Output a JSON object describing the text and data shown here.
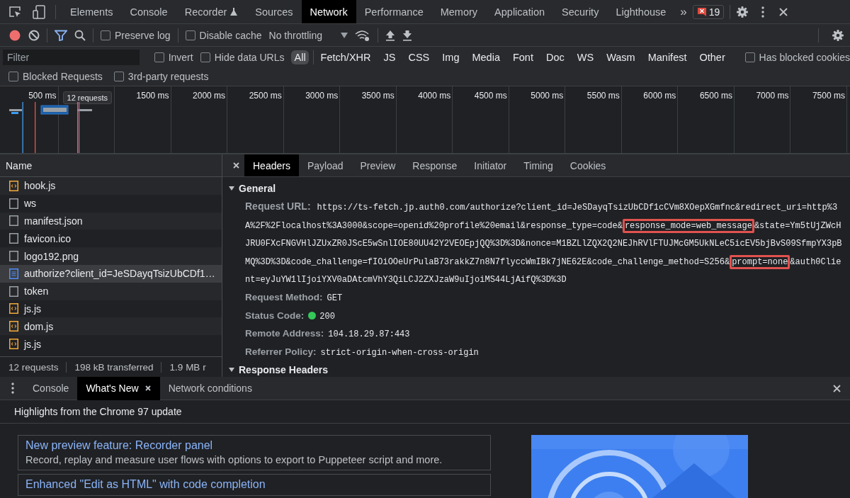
{
  "top_tabs": {
    "tabs": [
      {
        "label": "Elements",
        "selected": false
      },
      {
        "label": "Console",
        "selected": false
      },
      {
        "label": "Recorder",
        "selected": false,
        "experimental": true
      },
      {
        "label": "Sources",
        "selected": false
      },
      {
        "label": "Network",
        "selected": true
      },
      {
        "label": "Performance",
        "selected": false
      },
      {
        "label": "Memory",
        "selected": false
      },
      {
        "label": "Application",
        "selected": false
      },
      {
        "label": "Security",
        "selected": false
      },
      {
        "label": "Lighthouse",
        "selected": false
      }
    ],
    "more": "»",
    "error_count": "19"
  },
  "toolbar": {
    "recording": true,
    "filter_active": true,
    "checkboxes": [
      {
        "label": "Preserve log",
        "checked": false
      },
      {
        "label": "Disable cache",
        "checked": false
      }
    ],
    "throttling": "No throttling"
  },
  "filter_bar": {
    "placeholder": "Filter",
    "options": [
      {
        "label": "Invert",
        "checked": false
      },
      {
        "label": "Hide data URLs",
        "checked": false
      }
    ],
    "types": [
      {
        "label": "All",
        "selected": true
      },
      {
        "label": "Fetch/XHR",
        "selected": false
      },
      {
        "label": "JS",
        "selected": false
      },
      {
        "label": "CSS",
        "selected": false
      },
      {
        "label": "Img",
        "selected": false
      },
      {
        "label": "Media",
        "selected": false
      },
      {
        "label": "Font",
        "selected": false
      },
      {
        "label": "Doc",
        "selected": false
      },
      {
        "label": "WS",
        "selected": false
      },
      {
        "label": "Wasm",
        "selected": false
      },
      {
        "label": "Manifest",
        "selected": false
      },
      {
        "label": "Other",
        "selected": false
      }
    ],
    "blocked_cookies": {
      "label": "Has blocked cookies",
      "checked": false
    },
    "second_row": [
      {
        "label": "Blocked Requests",
        "checked": false
      },
      {
        "label": "3rd-party requests",
        "checked": false
      }
    ]
  },
  "overview": {
    "ticks": [
      "500 ms",
      "1500 ms",
      "2000 ms",
      "2500 ms",
      "3000 ms",
      "3500 ms",
      "4000 ms",
      "4500 ms",
      "5000 ms",
      "5500 ms",
      "6000 ms",
      "6500 ms",
      "7000 ms",
      "7500 ms"
    ],
    "tooltip": "12 requests"
  },
  "requests": {
    "header": "Name",
    "rows": [
      {
        "name": "hook.js",
        "kind": "script",
        "selected": false
      },
      {
        "name": "ws",
        "kind": "other",
        "selected": false
      },
      {
        "name": "manifest.json",
        "kind": "other",
        "selected": false
      },
      {
        "name": "favicon.ico",
        "kind": "other",
        "selected": false
      },
      {
        "name": "logo192.png",
        "kind": "other",
        "selected": false
      },
      {
        "name": "authorize?client_id=JeSDayqTsizUbCDf1…",
        "kind": "document",
        "selected": true
      },
      {
        "name": "token",
        "kind": "other",
        "selected": false
      },
      {
        "name": "js.js",
        "kind": "script",
        "selected": false
      },
      {
        "name": "dom.js",
        "kind": "script",
        "selected": false
      },
      {
        "name": "js.js",
        "kind": "script",
        "selected": false
      }
    ]
  },
  "summary": [
    "12 requests",
    "198 kB transferred",
    "1.9 MB r"
  ],
  "details": {
    "tabs": [
      {
        "label": "Headers",
        "selected": true
      },
      {
        "label": "Payload",
        "selected": false
      },
      {
        "label": "Preview",
        "selected": false
      },
      {
        "label": "Response",
        "selected": false
      },
      {
        "label": "Initiator",
        "selected": false
      },
      {
        "label": "Timing",
        "selected": false
      },
      {
        "label": "Cookies",
        "selected": false
      }
    ],
    "sections": [
      {
        "title": "General",
        "expanded": true,
        "fields": [
          {
            "kind": "url",
            "label": "Request URL:",
            "segments": [
              {
                "text": "https://ts-fetch.jp.auth0.com/authorize?client_id=JeSDayqTsizUbCDf1cCVm8XOepXGmfnc&redirect_uri=http%3A%2F%2Flocalhost%3A3000&scope=openid%20profile%20email&response_type=code&",
                "highlighted": false
              },
              {
                "text": "response_mode=web_message",
                "highlighted": true
              },
              {
                "text": "&state=Ym5tUjZWcHJRU0FXcFNGVHlJZUxZR0JScE5wSnlIOE80UU42Y2VEOEpjQQ%3D%3D&nonce=M1BZLlZQX2Q2NEJhRVlFTUJMcGM5UkNLeC5icEV5bjBvS09SfmpYX3pBMQ%3D%3D&code_challenge=fIOiOOeUrPulaB73rakkZ7n8N7flyccWmIBk7jNE62E&code_challenge_method=S256&",
                "highlighted": false
              },
              {
                "text": "prompt=none",
                "highlighted": true
              },
              {
                "text": "&auth0Client=eyJuYW1lIjoiYXV0aDAtcmVhY3QiLCJ2ZXJzaW9uIjoiMS44LjAifQ%3D%3D",
                "highlighted": false
              }
            ]
          },
          {
            "kind": "text",
            "label": "Request Method:",
            "value": "GET"
          },
          {
            "kind": "status",
            "label": "Status Code:",
            "value": "200",
            "color": "#34c759"
          },
          {
            "kind": "text",
            "label": "Remote Address:",
            "value": "104.18.29.87:443"
          },
          {
            "kind": "text",
            "label": "Referrer Policy:",
            "value": "strict-origin-when-cross-origin"
          }
        ]
      },
      {
        "title": "Response Headers",
        "expanded": true
      }
    ]
  },
  "drawer": {
    "tabs": [
      {
        "label": "Console",
        "selected": false,
        "closable": false
      },
      {
        "label": "What's New",
        "selected": true,
        "closable": true
      },
      {
        "label": "Network conditions",
        "selected": false,
        "closable": false
      }
    ],
    "title": "Highlights from the Chrome 97 update",
    "cards": [
      {
        "title": "New preview feature: Recorder panel",
        "description": "Record, replay and measure user flows with options to export to Puppeteer script and more."
      },
      {
        "title": "Enhanced \"Edit as HTML\" with code completion"
      }
    ]
  }
}
